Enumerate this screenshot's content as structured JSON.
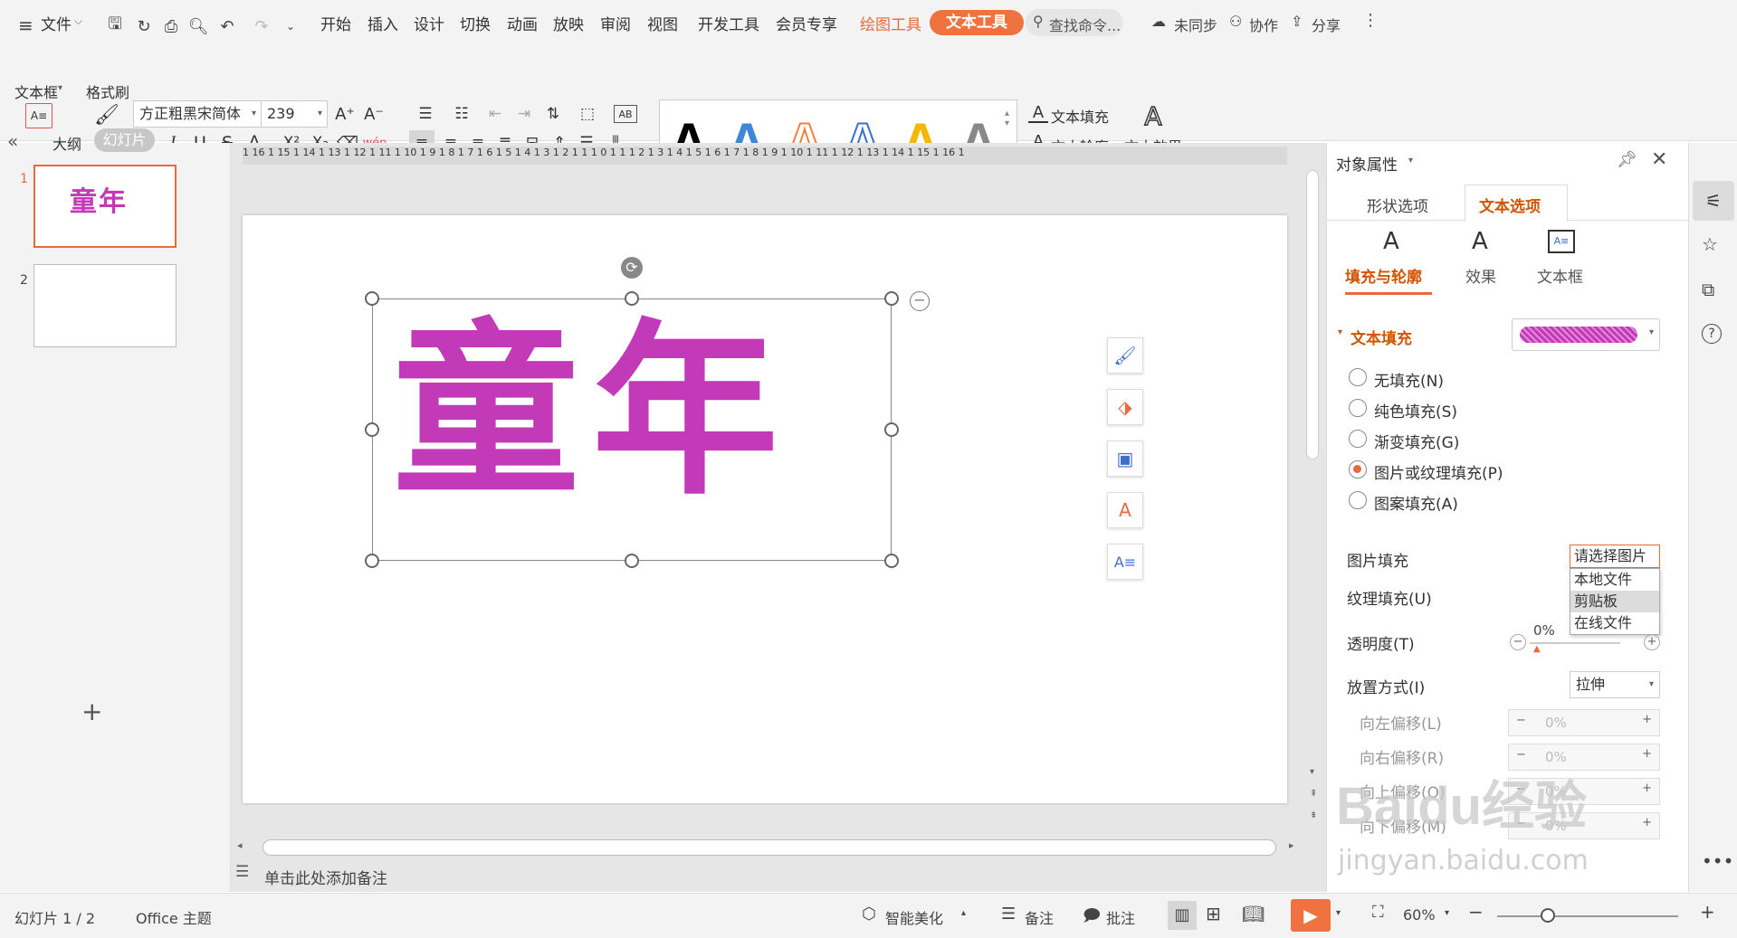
{
  "menu": {
    "file_label": "文件"
  },
  "tabs": [
    "开始",
    "插入",
    "设计",
    "切换",
    "动画",
    "放映",
    "审阅",
    "视图",
    "开发工具",
    "会员专享",
    "绘图工具",
    "文本工具"
  ],
  "search": {
    "placeholder": "查找命令..."
  },
  "top_right": {
    "sync": "未同步",
    "collab": "协作",
    "share": "分享"
  },
  "ribbon": {
    "textbox_label": "文本框",
    "format_painter": "格式刷",
    "font_name": "方正粗黑宋简体",
    "font_size": "239",
    "text_fill": "文本填充",
    "text_outline": "文本轮廓",
    "text_effect": "文本效果"
  },
  "sidebar": {
    "tab_outline": "大纲",
    "tab_slides": "幻灯片",
    "slides": [
      {
        "num": "1",
        "title": "童年"
      },
      {
        "num": "2",
        "title": ""
      }
    ]
  },
  "ruler": {
    "ticks": "1 16 1 15 1 14 1 13 1 12 1 11 1 10 1 9 1 8 1 7 1 6 1 5 1 4 1 3 1 2 1 1 1 0 1 1 1 2 1 3 1 4 1 5 1 6 1 7 1 8 1 9 1 10 1 11 1 12 1 13 1 14 1 15 1 16 1"
  },
  "slide": {
    "text": "童年",
    "text_color": "#c23ab8"
  },
  "notes": {
    "placeholder": "单击此处添加备注"
  },
  "panel": {
    "title": "对象属性",
    "tab_shape": "形状选项",
    "tab_text": "文本选项",
    "sub_fill": "填充与轮廓",
    "sub_effect": "效果",
    "sub_textbox": "文本框",
    "section_fill": "文本填充",
    "options": [
      "无填充(N)",
      "纯色填充(S)",
      "渐变填充(G)",
      "图片或纹理填充(P)",
      "图案填充(A)"
    ],
    "picture_fill_label": "图片填充",
    "picture_fill_value": "请选择图片",
    "dropdown_items": [
      "本地文件",
      "剪贴板",
      "在线文件"
    ],
    "texture_fill_label": "纹理填充(U)",
    "transparency_label": "透明度(T)",
    "transparency_value": "0%",
    "placement_label": "放置方式(I)",
    "placement_value": "拉伸",
    "offsets": [
      {
        "label": "向左偏移(L)",
        "value": "0%"
      },
      {
        "label": "向右偏移(R)",
        "value": "0%"
      },
      {
        "label": "向上偏移(O)",
        "value": "0%"
      },
      {
        "label": "向下偏移(M)",
        "value": "0%"
      }
    ]
  },
  "status": {
    "slide_count": "幻灯片 1 / 2",
    "theme": "Office 主题",
    "smart_beautify": "智能美化",
    "notes": "备注",
    "comments": "批注",
    "zoom": "60%"
  },
  "watermark": {
    "text": "Baidu经验",
    "sub": "jingyan.baidu.com"
  },
  "colors": {
    "accent": "#e8693a",
    "text_magenta": "#c23ab8",
    "panel_active": "#d35400"
  }
}
